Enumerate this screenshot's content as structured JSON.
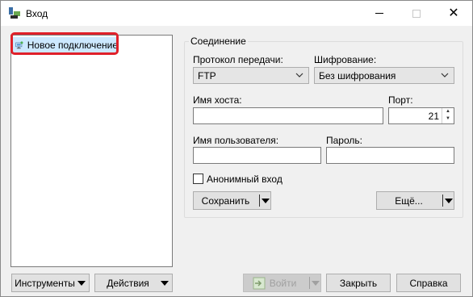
{
  "window": {
    "title": "Вход"
  },
  "tree": {
    "items": [
      {
        "label": "Новое подключение",
        "selected": true
      }
    ]
  },
  "connection": {
    "group_title": "Соединение",
    "protocol_label": "Протокол передачи:",
    "protocol_value": "FTP",
    "encryption_label": "Шифрование:",
    "encryption_value": "Без шифрования",
    "host_label": "Имя хоста:",
    "host_value": "",
    "port_label": "Порт:",
    "port_value": "21",
    "user_label": "Имя пользователя:",
    "user_value": "",
    "password_label": "Пароль:",
    "password_value": "",
    "anonymous_label": "Анонимный вход",
    "anonymous_checked": false,
    "save_label": "Сохранить",
    "more_label": "Ещё..."
  },
  "footer": {
    "tools_label": "Инструменты",
    "actions_label": "Действия",
    "login_label": "Войти",
    "close_label": "Закрыть",
    "help_label": "Справка"
  },
  "colors": {
    "selection": "#cce8ff",
    "highlight_border": "#e0202a",
    "window_bg": "#f0f0f0"
  }
}
